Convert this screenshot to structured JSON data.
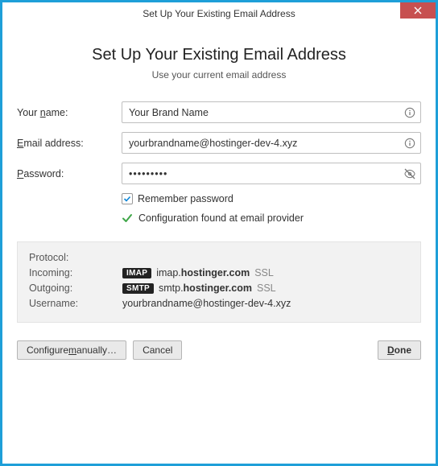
{
  "titlebar": {
    "title": "Set Up Your Existing Email Address"
  },
  "heading": "Set Up Your Existing Email Address",
  "subheading": "Use your current email address",
  "form": {
    "name": {
      "label_pre": "Your ",
      "label_u": "n",
      "label_post": "ame:",
      "value": "Your Brand Name"
    },
    "email": {
      "label_u": "E",
      "label_post": "mail address:",
      "value": "yourbrandname@hostinger-dev-4.xyz"
    },
    "password": {
      "label_u": "P",
      "label_post": "assword:",
      "value": "•••••••••"
    },
    "remember": {
      "label_pre": "Re",
      "label_u": "m",
      "label_post": "ember password",
      "checked": true
    }
  },
  "status": {
    "text": "Configuration found at email provider"
  },
  "protocols": {
    "header_protocol": "Protocol:",
    "header_incoming": "Incoming:",
    "header_outgoing": "Outgoing:",
    "header_username": "Username:",
    "incoming": {
      "badge": "IMAP",
      "pre": "imap.",
      "bold": "hostinger.com",
      "suffix": "SSL"
    },
    "outgoing": {
      "badge": "SMTP",
      "pre": "smtp.",
      "bold": "hostinger.com",
      "suffix": "SSL"
    },
    "username": "yourbrandname@hostinger-dev-4.xyz"
  },
  "buttons": {
    "configure": "Configure manually…",
    "cancel": "Cancel",
    "done": "Done"
  }
}
